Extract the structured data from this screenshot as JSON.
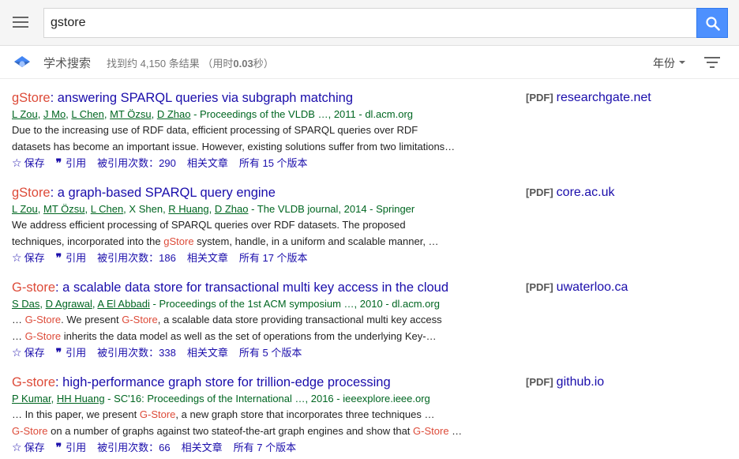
{
  "search": {
    "query": "gstore"
  },
  "header": {
    "brand": "学术搜索",
    "stats_prefix": "找到约 4,150 条结果 （用时",
    "stats_time": "0.03",
    "stats_suffix": "秒）",
    "year_label": "年份"
  },
  "colors": {
    "link": "#1a0dab",
    "green": "#006621",
    "highlight": "#dd4b39",
    "search_button": "#4d90fe"
  },
  "results": [
    {
      "title_hl": "gStore",
      "title_rest": ": answering SPARQL queries via subgraph matching",
      "authors": [
        "L Zou",
        "J Mo",
        "L Chen",
        "MT Özsu",
        "D Zhao"
      ],
      "source": " - Proceedings of the VLDB …, 2011 - dl.acm.org",
      "snippet1": [
        {
          "t": "Due to the increasing use of RDF data, efficient processing of SPARQL queries over RDF",
          "hl": false
        }
      ],
      "snippet2": [
        {
          "t": "datasets has become an important issue. However, existing solutions suffer from two limitations…",
          "hl": false
        }
      ],
      "save": "保存",
      "cite": "引用",
      "cited_by": "被引用次数：290",
      "related": "相关文章",
      "versions": "所有 15 个版本",
      "pdf_tag": "[PDF]",
      "pdf_site": "researchgate.net"
    },
    {
      "title_hl": "gStore",
      "title_rest": ": a graph-based SPARQL query engine",
      "authors": [
        "L Zou",
        "MT Özsu",
        "L Chen",
        "X Shen",
        "R Huang",
        "D Zhao"
      ],
      "authors_plain": [
        "X Shen"
      ],
      "source": " - The VLDB journal, 2014 - Springer",
      "snippet1": [
        {
          "t": "We address efficient processing of SPARQL queries over RDF datasets. The proposed",
          "hl": false
        }
      ],
      "snippet2": [
        {
          "t": "techniques, incorporated into the ",
          "hl": false
        },
        {
          "t": "gStore",
          "hl": true
        },
        {
          "t": " system, handle, in a uniform and scalable manner, …",
          "hl": false
        }
      ],
      "save": "保存",
      "cite": "引用",
      "cited_by": "被引用次数：186",
      "related": "相关文章",
      "versions": "所有 17 个版本",
      "pdf_tag": "[PDF]",
      "pdf_site": "core.ac.uk"
    },
    {
      "title_hl": "G-store",
      "title_rest": ": a scalable data store for transactional multi key access in the cloud",
      "authors": [
        "S Das",
        "D Agrawal",
        "A El Abbadi"
      ],
      "source": " - Proceedings of the 1st ACM symposium …, 2010 - dl.acm.org",
      "snippet1": [
        {
          "t": "… ",
          "hl": false
        },
        {
          "t": "G-Store",
          "hl": true
        },
        {
          "t": ". We present ",
          "hl": false
        },
        {
          "t": "G-Store",
          "hl": true
        },
        {
          "t": ", a scalable data store providing transactional multi key access",
          "hl": false
        }
      ],
      "snippet2": [
        {
          "t": "… ",
          "hl": false
        },
        {
          "t": "G-Store",
          "hl": true
        },
        {
          "t": " inherits the data model as well as the set of operations from the underlying Key-…",
          "hl": false
        }
      ],
      "save": "保存",
      "cite": "引用",
      "cited_by": "被引用次数：338",
      "related": "相关文章",
      "versions": "所有 5 个版本",
      "pdf_tag": "[PDF]",
      "pdf_site": "uwaterloo.ca"
    },
    {
      "title_hl": "G-store",
      "title_rest": ": high-performance graph store for trillion-edge processing",
      "authors": [
        "P Kumar",
        "HH Huang"
      ],
      "source": " - SC'16: Proceedings of the International …, 2016 - ieeexplore.ieee.org",
      "snippet1": [
        {
          "t": "… In this paper, we present ",
          "hl": false
        },
        {
          "t": "G-Store",
          "hl": true
        },
        {
          "t": ", a new graph store that incorporates three techniques …",
          "hl": false
        }
      ],
      "snippet2": [
        {
          "t": "G-Store",
          "hl": true
        },
        {
          "t": " on a number of graphs against two stateof-the-art graph engines and show that ",
          "hl": false
        },
        {
          "t": "G-Store",
          "hl": true
        },
        {
          "t": " …",
          "hl": false
        }
      ],
      "save": "保存",
      "cite": "引用",
      "cited_by": "被引用次数：66",
      "related": "相关文章",
      "versions": "所有 7 个版本",
      "pdf_tag": "[PDF]",
      "pdf_site": "github.io"
    }
  ]
}
